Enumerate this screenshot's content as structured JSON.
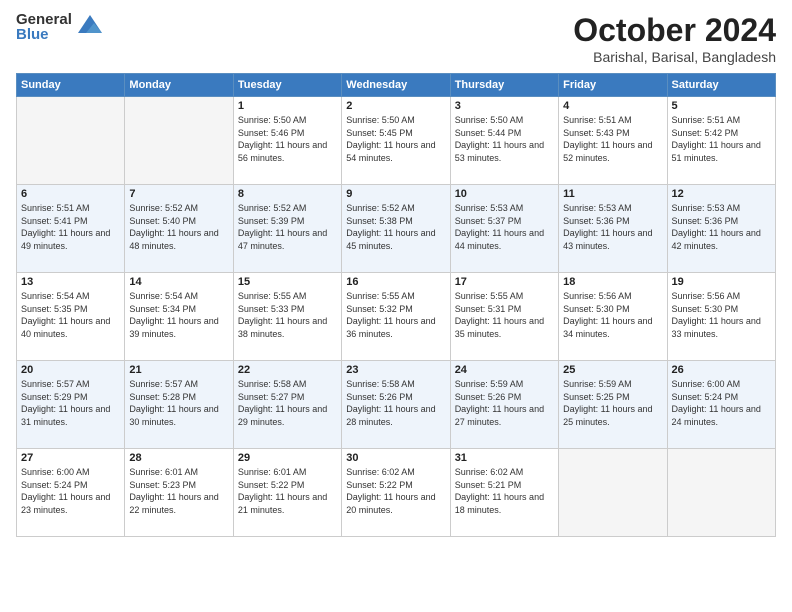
{
  "logo": {
    "general": "General",
    "blue": "Blue"
  },
  "header": {
    "month": "October 2024",
    "location": "Barishal, Barisal, Bangladesh"
  },
  "weekdays": [
    "Sunday",
    "Monday",
    "Tuesday",
    "Wednesday",
    "Thursday",
    "Friday",
    "Saturday"
  ],
  "weeks": [
    [
      {
        "day": "",
        "info": ""
      },
      {
        "day": "",
        "info": ""
      },
      {
        "day": "1",
        "info": "Sunrise: 5:50 AM\nSunset: 5:46 PM\nDaylight: 11 hours and 56 minutes."
      },
      {
        "day": "2",
        "info": "Sunrise: 5:50 AM\nSunset: 5:45 PM\nDaylight: 11 hours and 54 minutes."
      },
      {
        "day": "3",
        "info": "Sunrise: 5:50 AM\nSunset: 5:44 PM\nDaylight: 11 hours and 53 minutes."
      },
      {
        "day": "4",
        "info": "Sunrise: 5:51 AM\nSunset: 5:43 PM\nDaylight: 11 hours and 52 minutes."
      },
      {
        "day": "5",
        "info": "Sunrise: 5:51 AM\nSunset: 5:42 PM\nDaylight: 11 hours and 51 minutes."
      }
    ],
    [
      {
        "day": "6",
        "info": "Sunrise: 5:51 AM\nSunset: 5:41 PM\nDaylight: 11 hours and 49 minutes."
      },
      {
        "day": "7",
        "info": "Sunrise: 5:52 AM\nSunset: 5:40 PM\nDaylight: 11 hours and 48 minutes."
      },
      {
        "day": "8",
        "info": "Sunrise: 5:52 AM\nSunset: 5:39 PM\nDaylight: 11 hours and 47 minutes."
      },
      {
        "day": "9",
        "info": "Sunrise: 5:52 AM\nSunset: 5:38 PM\nDaylight: 11 hours and 45 minutes."
      },
      {
        "day": "10",
        "info": "Sunrise: 5:53 AM\nSunset: 5:37 PM\nDaylight: 11 hours and 44 minutes."
      },
      {
        "day": "11",
        "info": "Sunrise: 5:53 AM\nSunset: 5:36 PM\nDaylight: 11 hours and 43 minutes."
      },
      {
        "day": "12",
        "info": "Sunrise: 5:53 AM\nSunset: 5:36 PM\nDaylight: 11 hours and 42 minutes."
      }
    ],
    [
      {
        "day": "13",
        "info": "Sunrise: 5:54 AM\nSunset: 5:35 PM\nDaylight: 11 hours and 40 minutes."
      },
      {
        "day": "14",
        "info": "Sunrise: 5:54 AM\nSunset: 5:34 PM\nDaylight: 11 hours and 39 minutes."
      },
      {
        "day": "15",
        "info": "Sunrise: 5:55 AM\nSunset: 5:33 PM\nDaylight: 11 hours and 38 minutes."
      },
      {
        "day": "16",
        "info": "Sunrise: 5:55 AM\nSunset: 5:32 PM\nDaylight: 11 hours and 36 minutes."
      },
      {
        "day": "17",
        "info": "Sunrise: 5:55 AM\nSunset: 5:31 PM\nDaylight: 11 hours and 35 minutes."
      },
      {
        "day": "18",
        "info": "Sunrise: 5:56 AM\nSunset: 5:30 PM\nDaylight: 11 hours and 34 minutes."
      },
      {
        "day": "19",
        "info": "Sunrise: 5:56 AM\nSunset: 5:30 PM\nDaylight: 11 hours and 33 minutes."
      }
    ],
    [
      {
        "day": "20",
        "info": "Sunrise: 5:57 AM\nSunset: 5:29 PM\nDaylight: 11 hours and 31 minutes."
      },
      {
        "day": "21",
        "info": "Sunrise: 5:57 AM\nSunset: 5:28 PM\nDaylight: 11 hours and 30 minutes."
      },
      {
        "day": "22",
        "info": "Sunrise: 5:58 AM\nSunset: 5:27 PM\nDaylight: 11 hours and 29 minutes."
      },
      {
        "day": "23",
        "info": "Sunrise: 5:58 AM\nSunset: 5:26 PM\nDaylight: 11 hours and 28 minutes."
      },
      {
        "day": "24",
        "info": "Sunrise: 5:59 AM\nSunset: 5:26 PM\nDaylight: 11 hours and 27 minutes."
      },
      {
        "day": "25",
        "info": "Sunrise: 5:59 AM\nSunset: 5:25 PM\nDaylight: 11 hours and 25 minutes."
      },
      {
        "day": "26",
        "info": "Sunrise: 6:00 AM\nSunset: 5:24 PM\nDaylight: 11 hours and 24 minutes."
      }
    ],
    [
      {
        "day": "27",
        "info": "Sunrise: 6:00 AM\nSunset: 5:24 PM\nDaylight: 11 hours and 23 minutes."
      },
      {
        "day": "28",
        "info": "Sunrise: 6:01 AM\nSunset: 5:23 PM\nDaylight: 11 hours and 22 minutes."
      },
      {
        "day": "29",
        "info": "Sunrise: 6:01 AM\nSunset: 5:22 PM\nDaylight: 11 hours and 21 minutes."
      },
      {
        "day": "30",
        "info": "Sunrise: 6:02 AM\nSunset: 5:22 PM\nDaylight: 11 hours and 20 minutes."
      },
      {
        "day": "31",
        "info": "Sunrise: 6:02 AM\nSunset: 5:21 PM\nDaylight: 11 hours and 18 minutes."
      },
      {
        "day": "",
        "info": ""
      },
      {
        "day": "",
        "info": ""
      }
    ]
  ]
}
